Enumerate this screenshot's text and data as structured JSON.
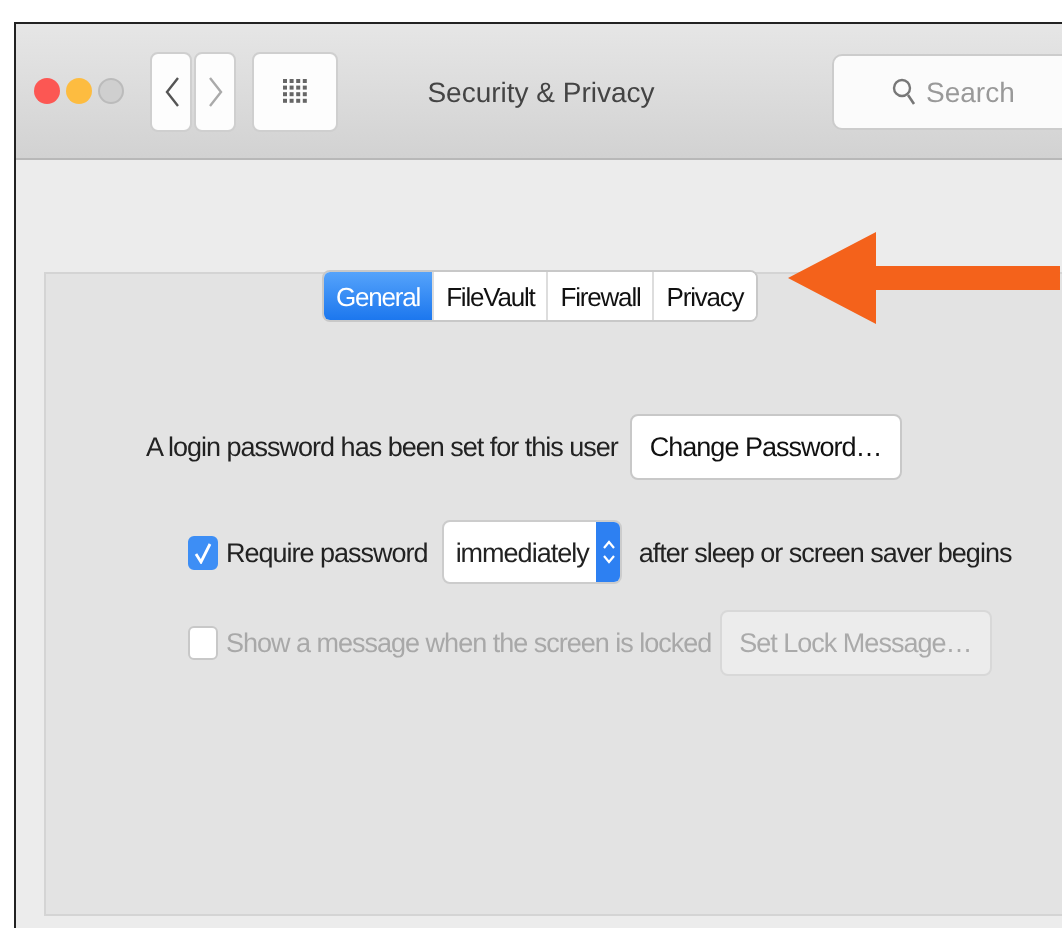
{
  "window": {
    "title": "Security & Privacy",
    "search": {
      "placeholder": "Search"
    }
  },
  "tabs": [
    {
      "label": "General",
      "selected": true
    },
    {
      "label": "FileVault",
      "selected": false
    },
    {
      "label": "Firewall",
      "selected": false
    },
    {
      "label": "Privacy",
      "selected": false
    }
  ],
  "rows": [
    {
      "kind": "label-button",
      "label": "A login password has been set for this user",
      "button": "Change Password…",
      "disabled": false
    },
    {
      "kind": "checkbox-select",
      "label": "Require password",
      "checked": true,
      "value": "immediately",
      "after": "after sleep or screen saver begins",
      "disabled": false
    },
    {
      "kind": "checkbox-button",
      "label": "Show a message when the screen is locked",
      "checked": false,
      "button": "Set Lock Message…",
      "disabled": true
    }
  ]
}
